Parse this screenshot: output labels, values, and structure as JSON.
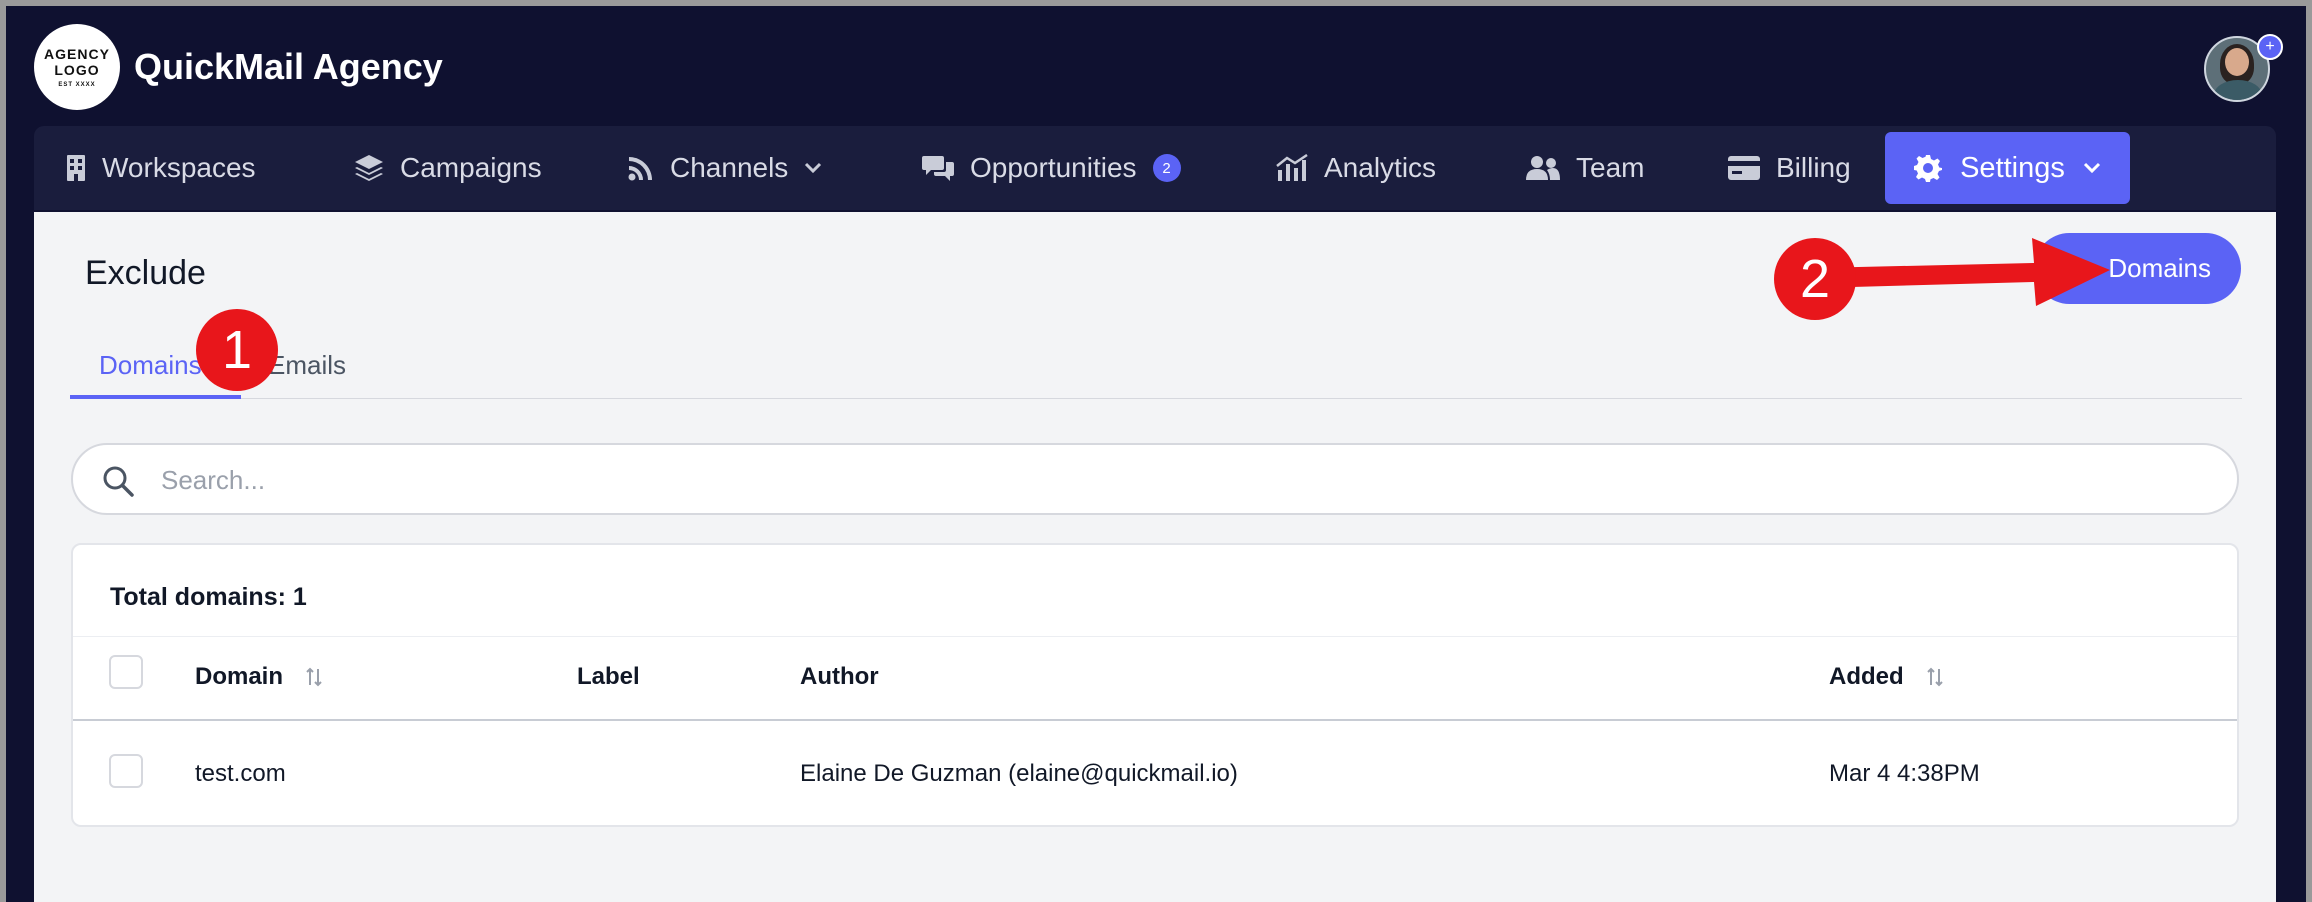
{
  "header": {
    "logo_line1": "AGENCY",
    "logo_line2": "LOGO",
    "logo_line3": "EST XXXX",
    "agency_name": "QuickMail Agency",
    "avatar_badge": "+"
  },
  "nav": {
    "items": [
      {
        "label": "Workspaces",
        "icon": "building-icon"
      },
      {
        "label": "Campaigns",
        "icon": "layers-icon"
      },
      {
        "label": "Channels",
        "icon": "rss-icon"
      },
      {
        "label": "Opportunities",
        "icon": "chat-icon",
        "badge": "2"
      },
      {
        "label": "Analytics",
        "icon": "chart-icon"
      },
      {
        "label": "Team",
        "icon": "users-icon"
      },
      {
        "label": "Billing",
        "icon": "credit-card-icon"
      }
    ],
    "settings_label": "Settings"
  },
  "page": {
    "title": "Exclude",
    "add_button_label": "Domains",
    "tabs": [
      {
        "label": "Domains",
        "active": true
      },
      {
        "label": "Emails",
        "active": false
      }
    ],
    "search_placeholder": "Search...",
    "total_label": "Total domains: 1"
  },
  "table": {
    "columns": [
      "Domain",
      "Label",
      "Author",
      "Added"
    ],
    "rows": [
      {
        "domain": "test.com",
        "label": "",
        "author": "Elaine De Guzman (elaine@quickmail.io)",
        "added": "Mar 4 4:38PM"
      }
    ]
  },
  "annotations": {
    "marker1": "1",
    "marker2": "2"
  },
  "colors": {
    "accent": "#5b63f5",
    "header_bg": "#0f1130",
    "nav_bg": "#1a1d3d",
    "annotation_red": "#e8161b"
  }
}
